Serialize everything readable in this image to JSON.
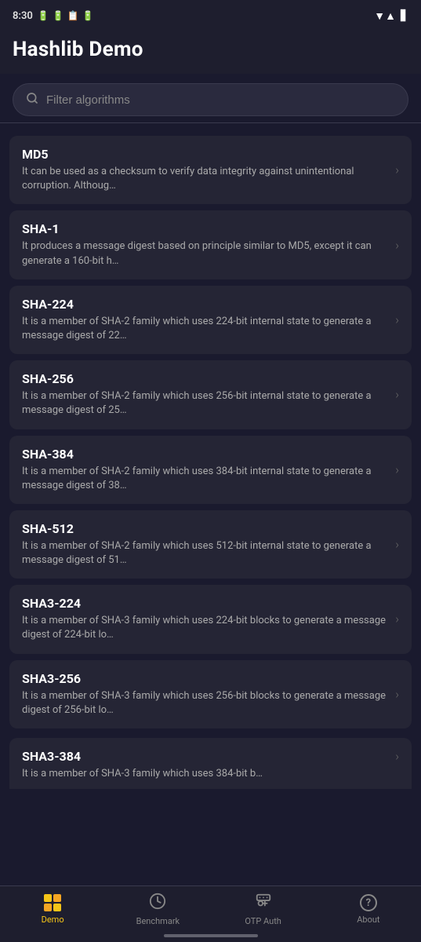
{
  "statusBar": {
    "time": "8:30",
    "wifi": "▼",
    "battery": "⬜"
  },
  "header": {
    "title": "Hashlib Demo"
  },
  "search": {
    "placeholder": "Filter algorithms"
  },
  "algorithms": [
    {
      "name": "MD5",
      "description": "It can be used as a checksum to verify data integrity against unintentional corruption. Althoug…"
    },
    {
      "name": "SHA-1",
      "description": "It produces a message digest based on principle similar to MD5, except it can generate a 160-bit h…"
    },
    {
      "name": "SHA-224",
      "description": "It is a member of SHA-2 family which uses 224-bit internal state to generate a message digest of 22…"
    },
    {
      "name": "SHA-256",
      "description": "It is a member of SHA-2 family which uses 256-bit internal state to generate a message digest of 25…"
    },
    {
      "name": "SHA-384",
      "description": "It is a member of SHA-2 family which uses 384-bit internal state to generate a message digest of 38…"
    },
    {
      "name": "SHA-512",
      "description": "It is a member of SHA-2 family which uses 512-bit internal state to generate a message digest of 51…"
    },
    {
      "name": "SHA3-224",
      "description": "It is a member of SHA-3 family which uses 224-bit blocks to generate a message digest of 224-bit lo…"
    },
    {
      "name": "SHA3-256",
      "description": "It is a member of SHA-3 family which uses 256-bit blocks to generate a message digest of 256-bit lo…"
    },
    {
      "name": "SHA3-384",
      "description": "It is a member of SHA-3 family which uses 384-bit b…"
    }
  ],
  "bottomNav": {
    "items": [
      {
        "id": "demo",
        "label": "Demo",
        "active": true
      },
      {
        "id": "benchmark",
        "label": "Benchmark",
        "active": false
      },
      {
        "id": "otp",
        "label": "OTP Auth",
        "active": false
      },
      {
        "id": "about",
        "label": "About",
        "active": false
      }
    ]
  },
  "colors": {
    "accent": "#f5c518",
    "background": "#1a1a2e",
    "card": "#252535",
    "header": "#1e1e2e"
  }
}
